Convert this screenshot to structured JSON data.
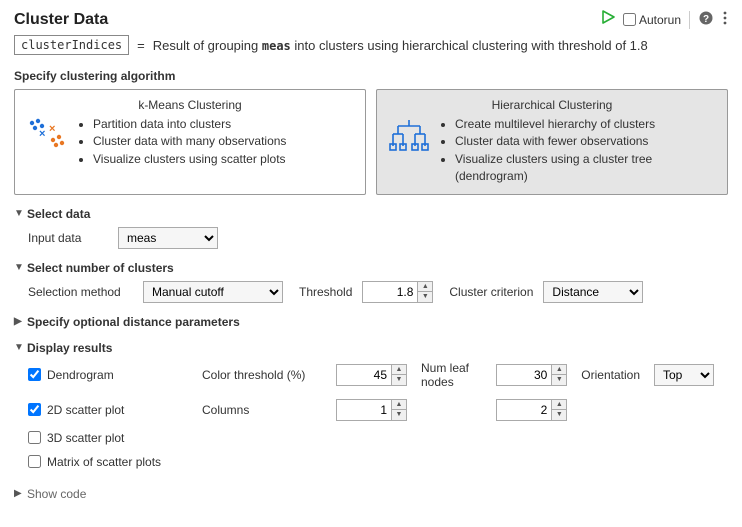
{
  "header": {
    "title": "Cluster Data",
    "autorun_label": "Autorun",
    "autorun_checked": false
  },
  "description": {
    "var_name": "clusterIndices",
    "equals": "=",
    "prefix": "Result of grouping ",
    "data_name": "meas",
    "suffix": " into clusters using hierarchical clustering with threshold of 1.8"
  },
  "algo_section_label": "Specify clustering algorithm",
  "algorithms": {
    "kmeans": {
      "title": "k-Means Clustering",
      "bullets": [
        "Partition data into clusters",
        "Cluster data with many observations",
        "Visualize clusters using scatter plots"
      ]
    },
    "hierarchical": {
      "title": "Hierarchical Clustering",
      "bullets": [
        "Create multilevel hierarchy of clusters",
        "Cluster data with fewer observations",
        "Visualize clusters using a cluster tree (dendrogram)"
      ]
    }
  },
  "sections": {
    "select_data": "Select data",
    "select_clusters": "Select number of clusters",
    "optional_distance": "Specify optional distance parameters",
    "display_results": "Display results",
    "show_code": "Show code"
  },
  "select_data": {
    "input_data_label": "Input data",
    "input_data_value": "meas"
  },
  "select_clusters": {
    "selection_method_label": "Selection method",
    "selection_method_value": "Manual cutoff",
    "threshold_label": "Threshold",
    "threshold_value": "1.8",
    "criterion_label": "Cluster criterion",
    "criterion_value": "Distance"
  },
  "display": {
    "dendrogram": {
      "label": "Dendrogram",
      "checked": true
    },
    "scatter2d": {
      "label": "2D scatter plot",
      "checked": true
    },
    "scatter3d": {
      "label": "3D scatter plot",
      "checked": false
    },
    "matrix": {
      "label": "Matrix of scatter plots",
      "checked": false
    },
    "color_thresh_label": "Color threshold (%)",
    "color_thresh_value": "45",
    "num_leaf_label": "Num leaf nodes",
    "num_leaf_value": "30",
    "orientation_label": "Orientation",
    "orientation_value": "Top",
    "columns_label": "Columns",
    "col1_value": "1",
    "col2_value": "2"
  }
}
